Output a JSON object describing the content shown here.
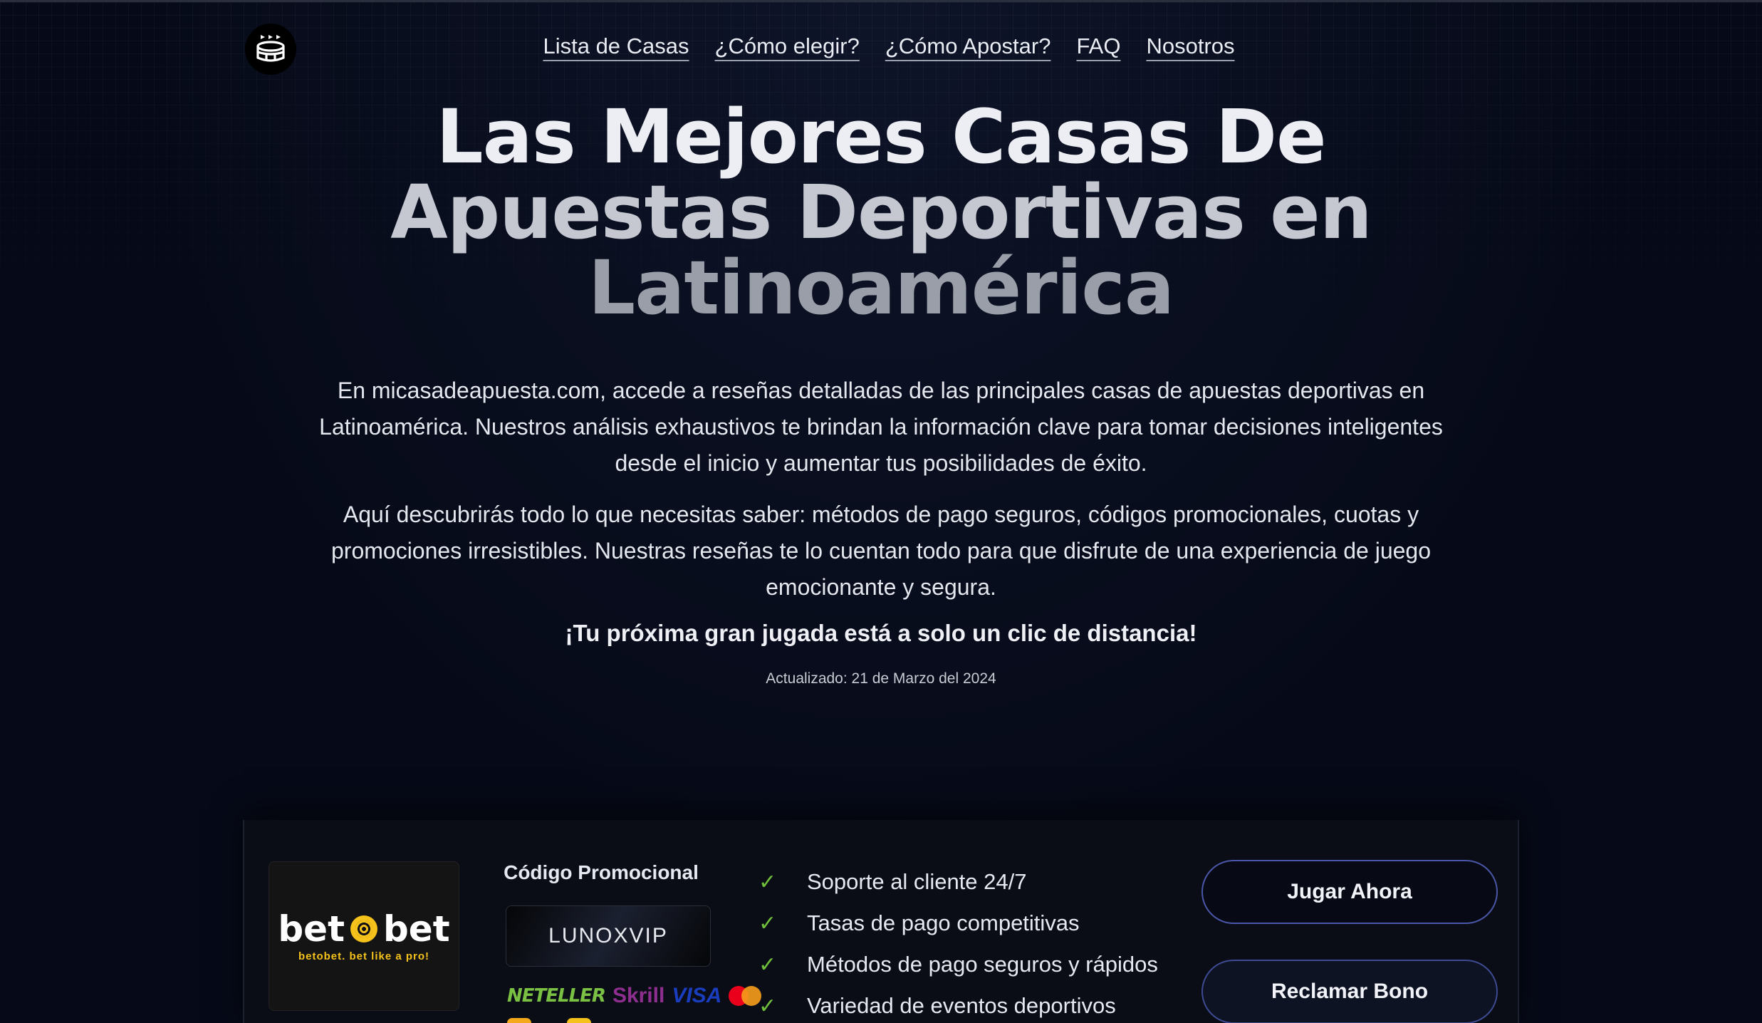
{
  "header": {
    "logo_icon": "stadium-icon",
    "nav": [
      {
        "label": "Lista de Casas"
      },
      {
        "label": "¿Cómo elegir?"
      },
      {
        "label": "¿Cómo Apostar?"
      },
      {
        "label": "FAQ"
      },
      {
        "label": "Nosotros"
      }
    ]
  },
  "hero": {
    "title_line1": "Las Mejores Casas De",
    "title_line2": "Apuestas Deportivas en",
    "title_line3": "Latinoamérica",
    "paragraph1": "En micasadeapuesta.com, accede a reseñas detalladas de las principales casas de apuestas deportivas en Latinoamérica. Nuestros análisis exhaustivos te brindan la información clave para tomar decisiones inteligentes desde el inicio y aumentar tus posibilidades de éxito.",
    "paragraph2": "Aquí descubrirás todo lo que necesitas saber: métodos de pago seguros, códigos promocionales, cuotas y promociones irresistibles. Nuestras reseñas te lo cuentan todo para que disfrute de una experiencia de juego emocionante y segura.",
    "cta": "¡Tu próxima gran jugada está a solo un clic de distancia!",
    "updated": "Actualizado: 21 de Marzo del 2024"
  },
  "card": {
    "brand_word1": "bet",
    "brand_word2": "bet",
    "brand_tagline": "betobet. bet like a pro!",
    "promo_label": "Código Promocional",
    "promo_code": "LUNOXVIP",
    "payments": [
      "NETELLER",
      "Skrill",
      "VISA",
      "MasterCard"
    ],
    "features": [
      "Soporte al cliente 24/7",
      "Tasas de pago competitivas",
      "Métodos de pago seguros y rápidos",
      "Variedad de eventos deportivos"
    ],
    "play_button": "Jugar Ahora",
    "claim_button": "Reclamar Bono"
  },
  "colors": {
    "background": "#060a18",
    "check": "#6fbf3a",
    "brand_accent": "#f4c21b",
    "button_border": "#4a56a8"
  }
}
